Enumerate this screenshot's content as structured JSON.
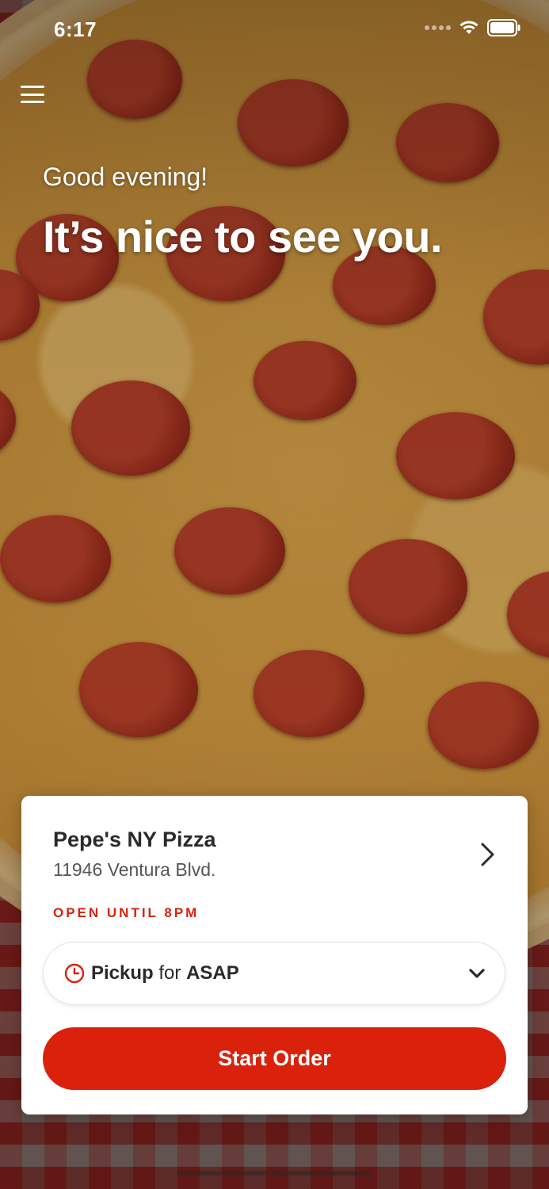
{
  "status_bar": {
    "time": "6:17"
  },
  "header": {
    "menu_icon": "hamburger-menu-icon",
    "greeting": "Good evening!",
    "headline": "It’s nice to see you."
  },
  "store": {
    "name": "Pepe's NY Pizza",
    "address": "11946 Ventura Blvd.",
    "hours": "OPEN UNTIL 8PM"
  },
  "order_mode": {
    "mode": "Pickup",
    "connector": "for",
    "time": "ASAP"
  },
  "actions": {
    "start_order": "Start Order"
  },
  "colors": {
    "accent": "#d9210c",
    "text_dark": "#2a2a2a",
    "text_muted": "#555555"
  }
}
